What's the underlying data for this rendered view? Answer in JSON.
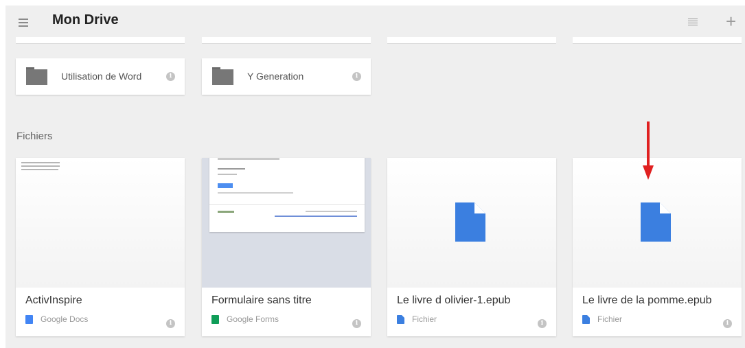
{
  "header": {
    "title": "Mon Drive"
  },
  "folders": [
    {
      "name": "Utilisation de Word"
    },
    {
      "name": "Y Generation"
    }
  ],
  "files_section": {
    "label": "Fichiers"
  },
  "files": [
    {
      "name": "ActivInspire",
      "type": "Google Docs",
      "type_color": "#4285f4"
    },
    {
      "name": "Formulaire sans titre",
      "type": "Google Forms",
      "type_color": "#0f9d58"
    },
    {
      "name": "Le livre d olivier-1.epub",
      "type": "Fichier",
      "type_color": "#3b7fe0"
    },
    {
      "name": "Le livre de la pomme.epub",
      "type": "Fichier",
      "type_color": "#3b7fe0"
    }
  ],
  "icons": {
    "menu": "hamburger-menu-icon",
    "list_view": "list-view-icon",
    "add": "plus-icon",
    "folder": "folder-icon",
    "info": "info-icon",
    "file": "file-icon",
    "annotation": "red-arrow"
  },
  "colors": {
    "background": "#efefef",
    "card": "#ffffff",
    "file_icon_blue": "#3b7fe0",
    "arrow_red": "#e02020"
  }
}
